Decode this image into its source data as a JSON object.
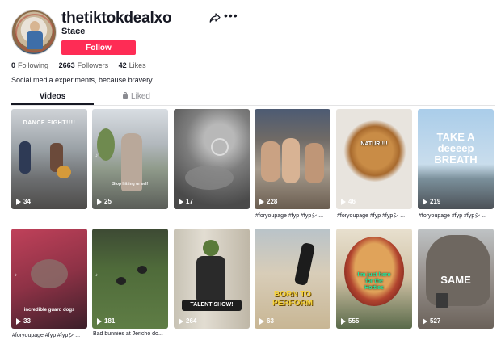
{
  "profile": {
    "username": "thetiktokdealxo",
    "nickname": "Stace",
    "follow_label": "Follow",
    "stats": [
      {
        "value": "0",
        "label": "Following"
      },
      {
        "value": "2663",
        "label": "Followers"
      },
      {
        "value": "42",
        "label": "Likes"
      }
    ],
    "bio": "Social media experiments, because bravery."
  },
  "tabs": {
    "videos": "Videos",
    "liked": "Liked"
  },
  "videos": [
    {
      "views": "34",
      "caption": "",
      "overlay": "DANCE FIGHT!!!!"
    },
    {
      "views": "25",
      "caption": "",
      "overlay": "Stop hitting ur self"
    },
    {
      "views": "17",
      "caption": "",
      "overlay": ""
    },
    {
      "views": "228",
      "caption": "#foryoupage #fyp #fypシ ...",
      "overlay": ""
    },
    {
      "views": "46",
      "caption": "#foryoupage #fyp #fypシ ...",
      "overlay": "NATUR!!!!"
    },
    {
      "views": "219",
      "caption": "#foryoupage #fyp #fypシ ...",
      "overlay": "TAKE A deeeep BREATH"
    },
    {
      "views": "33",
      "caption": "#foryoupage #fyp #fypシ ...",
      "overlay": "incredible guard dogs"
    },
    {
      "views": "181",
      "caption": "Bad bunnies at Jericho do...",
      "overlay": ""
    },
    {
      "views": "264",
      "caption": "",
      "overlay": "TALENT SHOW!"
    },
    {
      "views": "63",
      "caption": "",
      "overlay": "BORN TO PERFORM"
    },
    {
      "views": "555",
      "caption": "",
      "overlay": ""
    },
    {
      "views": "527",
      "caption": "",
      "overlay": "SAME"
    }
  ],
  "icons": {
    "share": "share-icon",
    "more": "more-icon",
    "lock": "lock-icon",
    "play": "play-icon"
  },
  "colors": {
    "accent": "#fe2c55",
    "text": "#161823",
    "muted": "#8a8b91"
  }
}
